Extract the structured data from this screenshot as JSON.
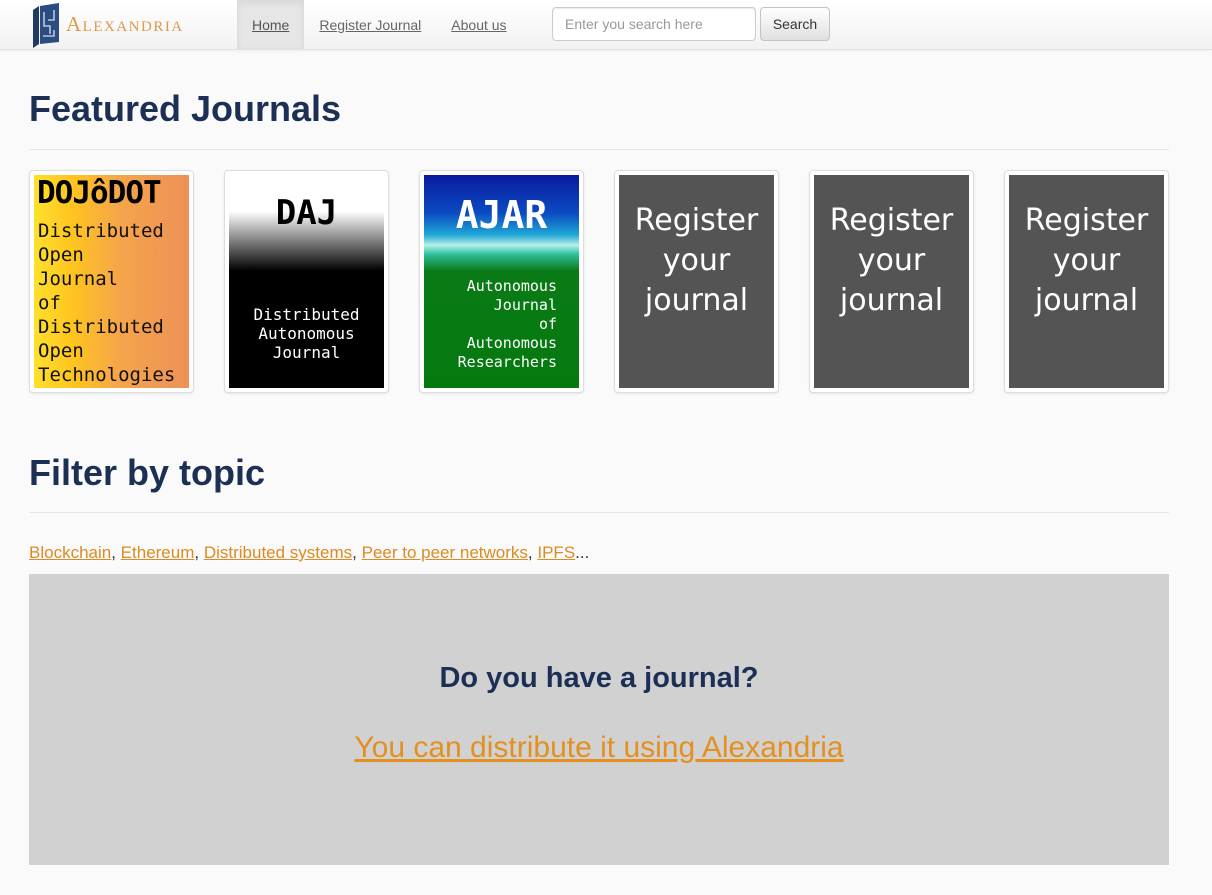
{
  "brand": {
    "name": "Alexandria",
    "logo_icon": "alexandria-logo-icon",
    "color": "#dc9a4a"
  },
  "nav": {
    "items": [
      {
        "label": "Home",
        "active": true
      },
      {
        "label": "Register Journal",
        "active": false
      },
      {
        "label": "About us",
        "active": false
      }
    ]
  },
  "search": {
    "placeholder": "Enter you search here",
    "value": "",
    "button_label": "Search"
  },
  "featured": {
    "title": "Featured Journals",
    "journals": [
      {
        "title": "DOJôDOT",
        "subtitle": "Distributed\nOpen\nJournal\nof\nDistributed\nOpen\nTechnologies"
      },
      {
        "title": "DAJ",
        "subtitle": "Distributed\nAutonomous\nJournal"
      },
      {
        "title": "AJAR",
        "subtitle": "Autonomous\nJournal\nof\nAutonomous\nResearchers"
      },
      {
        "title": "Register\nyour\njournal"
      },
      {
        "title": "Register\nyour\njournal"
      },
      {
        "title": "Register\nyour\njournal"
      }
    ]
  },
  "filter": {
    "title": "Filter by topic",
    "topics": [
      "Blockchain",
      "Ethereum",
      "Distributed systems",
      "Peer to peer networks",
      "IPFS"
    ],
    "ellipsis": "..."
  },
  "cta": {
    "question": "Do you have a journal?",
    "link": "You can distribute it using Alexandria"
  },
  "colors": {
    "heading": "#1c2f55",
    "link": "#dc8a22",
    "cta_bg": "#d1d1d1"
  }
}
